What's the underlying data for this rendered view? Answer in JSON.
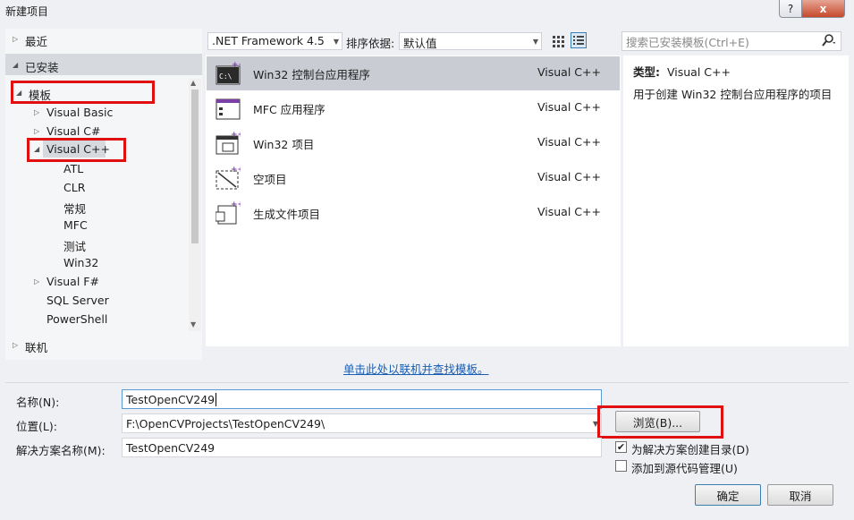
{
  "window": {
    "title": "新建项目",
    "help": "?",
    "close": "x"
  },
  "tree": {
    "recent": "最近",
    "installed": "已安装",
    "templates": "模板",
    "items": [
      "Visual Basic",
      "Visual C#",
      "Visual C++",
      "ATL",
      "CLR",
      "常规",
      "MFC",
      "测试",
      "Win32",
      "Visual F#",
      "SQL Server",
      "PowerShell"
    ],
    "online": "联机"
  },
  "toolbar": {
    "framework": ".NET Framework 4.5",
    "sort_label": "排序依据:",
    "sort_value": "默认值",
    "search_placeholder": "搜索已安装模板(Ctrl+E)"
  },
  "templates_list": [
    {
      "name": "Win32 控制台应用程序",
      "lang": "Visual C++"
    },
    {
      "name": "MFC 应用程序",
      "lang": "Visual C++"
    },
    {
      "name": "Win32 项目",
      "lang": "Visual C++"
    },
    {
      "name": "空项目",
      "lang": "Visual C++"
    },
    {
      "name": "生成文件项目",
      "lang": "Visual C++"
    }
  ],
  "details": {
    "type_label": "类型:",
    "type_value": "Visual C++",
    "description": "用于创建 Win32 控制台应用程序的项目"
  },
  "online_link": "单击此处以联机并查找模板。",
  "form": {
    "name_label": "名称(N):",
    "name_value": "TestOpenCV249",
    "location_label": "位置(L):",
    "location_value": "F:\\OpenCVProjects\\TestOpenCV249\\",
    "solution_label": "解决方案名称(M):",
    "solution_value": "TestOpenCV249",
    "browse": "浏览(B)...",
    "create_dir": "为解决方案创建目录(D)",
    "add_scc": "添加到源代码管理(U)",
    "ok": "确定",
    "cancel": "取消"
  },
  "colors": {
    "highlight": "#e01010",
    "accent": "#1a5fb4"
  }
}
